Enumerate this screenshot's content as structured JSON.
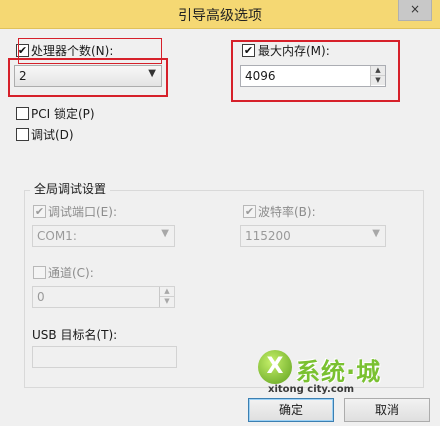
{
  "window": {
    "title": "引导高级选项",
    "close_icon": "×"
  },
  "processors": {
    "label": "处理器个数(N):",
    "checked": "✔",
    "value": "2"
  },
  "max_memory": {
    "label": "最大内存(M):",
    "checked": "✔",
    "value": "4096"
  },
  "pci_lock": {
    "label": "PCI 锁定(P)"
  },
  "debug": {
    "label": "调试(D)"
  },
  "global_debug": {
    "title": "全局调试设置",
    "debug_port": {
      "label": "调试端口(E):",
      "checked": "✔",
      "value": "COM1:"
    },
    "baud_rate": {
      "label": "波特率(B):",
      "checked": "✔",
      "value": "115200"
    },
    "channel": {
      "label": "通道(C):",
      "value": "0"
    },
    "usb_target": {
      "label": "USB 目标名(T):",
      "value": ""
    }
  },
  "buttons": {
    "ok": "确定",
    "cancel": "取消"
  },
  "watermark": {
    "logo": "X",
    "text": "系统·城",
    "sub": "xitong city.com"
  },
  "colors": {
    "titlebar": "#f5d873",
    "highlight_box": "#d6202a",
    "watermark_green": "#7ac131"
  }
}
